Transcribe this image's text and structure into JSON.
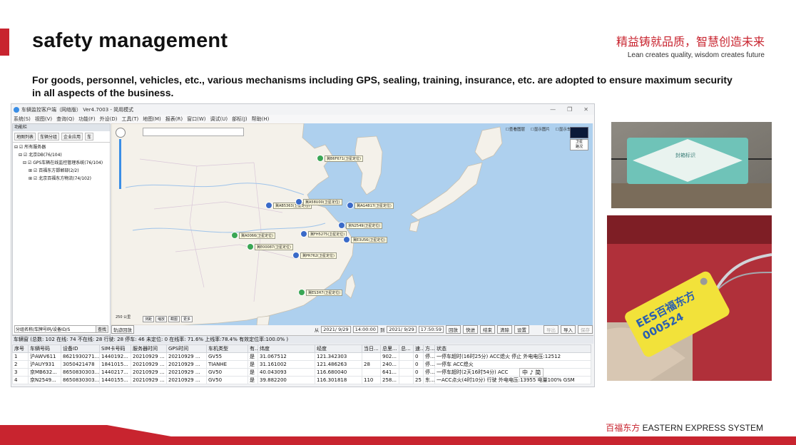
{
  "header": {
    "title": "safety management",
    "slogan_cn": "精益铸就品质，智慧创造未来",
    "slogan_en": "Lean creates quality, wisdom creates future",
    "description": "For goods, personnel, vehicles, etc., various mechanisms including GPS, sealing, training, insurance, etc. are adopted to ensure maximum security in all aspects of the business."
  },
  "window": {
    "title": "车辆监控客户端（网络版） Ver4.7003 - 简用模式",
    "menu": [
      "系统(S)",
      "视图(V)",
      "查询(Q)",
      "功能(F)",
      "外设(D)",
      "工具(T)",
      "地图(M)",
      "报表(R)",
      "窗口(W)",
      "调试(U)",
      "部标(J)",
      "帮助(H)"
    ],
    "left_panel": {
      "title": "功能栏",
      "tabs": [
        "地图列表",
        "车辆分组",
        "企业应用",
        "车"
      ],
      "tree": [
        "所有服务器",
        "北京DB(76/104)",
        "GPS车辆在线监控管理系统(76/104)",
        "百福东方邯郸部(2/2)",
        "北京百福东方物流(74/102)"
      ],
      "search_placeholder": "分组名称/车牌号码/设备ID/S",
      "search_button": "查找"
    },
    "map": {
      "legend": [
        "查看图层",
        "显示图片",
        "显示车辆"
      ],
      "maptype": [
        "卫星",
        "路况"
      ],
      "scale": "250 公里",
      "tools": [
        "测距",
        "缩放",
        "截图",
        "更多"
      ],
      "vehicles": [
        "冀B6F671(卫星定位)",
        "冀AB5363(卫星定位)",
        "冀A58U00(卫星定位)",
        "冀AG4817(卫星定位)",
        "冀FH5275(卫星定位)",
        "京N2549(卫星定位)",
        "冀E3U56(卫星定位)",
        "冀A0066(卫星定位)",
        "冀E00087(卫星定位)",
        "冀PR762(卫星定位)",
        "冀ES3H7(卫星定位)"
      ]
    },
    "toolbar": {
      "track_label": "轨迹回放",
      "from_label": "从",
      "from_date": "2021/ 9/29",
      "from_time": "14:00:00",
      "to_label": "到",
      "to_date": "2021/ 9/29",
      "to_time": "17:50:59",
      "buttons": [
        "回放",
        "快进",
        "结束",
        "清除",
        "设置"
      ],
      "extra_buttons": [
        "导出",
        "导入",
        "保存"
      ]
    },
    "grid": {
      "summary": "车辆窗   (总数: 102 在线: 74 不在线: 28 行驶: 28 停车: 46 未定位: 0  在线率: 71.6% 上线率:78.4% 有效定位率:100.0% )",
      "columns": [
        "序号",
        "车辆号码",
        "设备ID",
        "SIM卡号码",
        "服务器时间",
        "GPS时间",
        "车机类型",
        "有...",
        "纬度",
        "经度",
        "当日...",
        "总里...",
        "总...",
        "速...",
        "方...",
        "状态"
      ],
      "rows": [
        [
          "1",
          "沪AWV611",
          "8621930271...",
          "1440192...",
          "20210929 ...",
          "20210929 ...",
          "GV55",
          "是",
          "31.067512",
          "121.342303",
          "",
          "902...",
          "",
          "0",
          "停...",
          "一停车超时(16时25分) ACC熄火 停止 外电电压:12512"
        ],
        [
          "2",
          "沪AUY931",
          "3050421478",
          "1841015...",
          "20210929 ...",
          "20210929 ...",
          "TIANHE",
          "是",
          "31.161002",
          "121.486263",
          "28",
          "240...",
          "",
          "0",
          "停...",
          "一停车 ACC熄火"
        ],
        [
          "3",
          "京MB632...",
          "8650830303...",
          "1440217...",
          "20210929 ...",
          "20210929 ...",
          "GV50",
          "是",
          "40.043093",
          "116.680040",
          "",
          "641...",
          "",
          "0",
          "停...",
          "一停车超时(2天16时54分) ACC"
        ],
        [
          "4",
          "京N2549...",
          "8650830303...",
          "1440155...",
          "20210929 ...",
          "20210929 ...",
          "GV50",
          "是",
          "39.882200",
          "116.301818",
          "110",
          "258...",
          "",
          "25",
          "东...",
          "一ACC点火(4时10分) 行驶 外电电压:13955 电量100% GSM"
        ]
      ]
    },
    "ime": "中 ♪ 简"
  },
  "seal_label": "封箱标识",
  "seal_tag_text": "EES百福东方 000524",
  "footer": {
    "cn": "百福东方",
    "en": "EASTERN EXPRESS SYSTEM"
  },
  "colors": {
    "brand_red": "#c8242f"
  }
}
